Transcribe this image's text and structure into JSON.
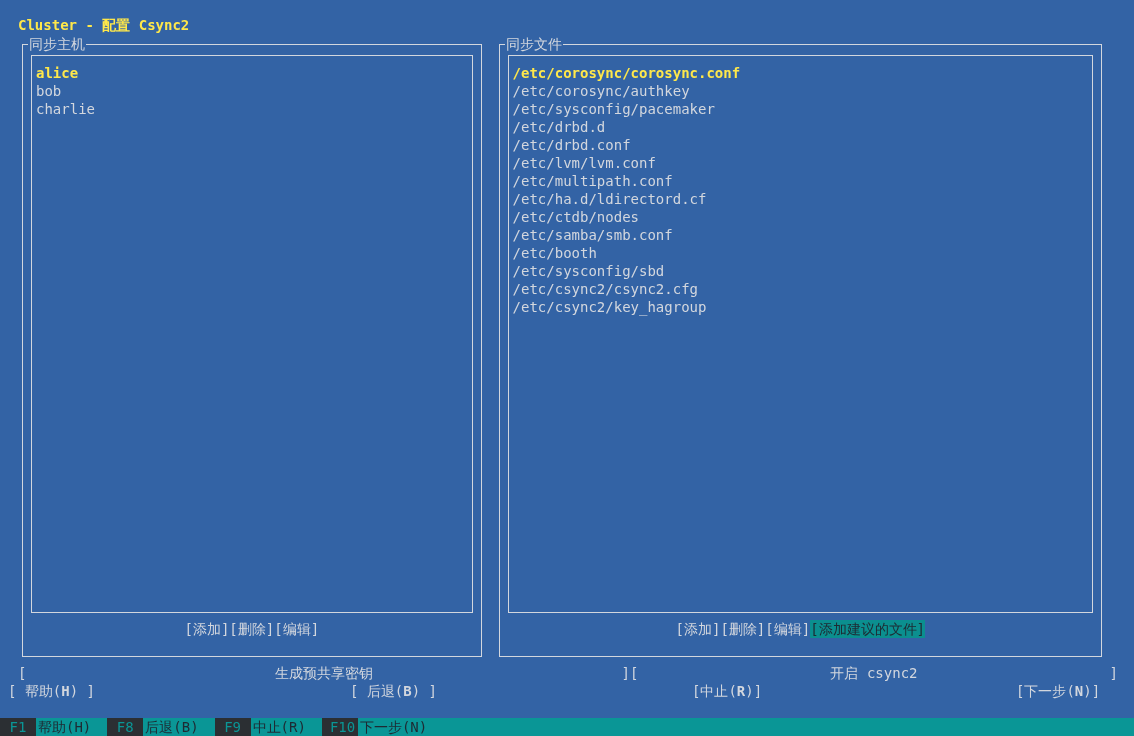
{
  "window": {
    "title": "Cluster - 配置 Csync2"
  },
  "panels": [
    {
      "title": "同步主机",
      "items": [
        {
          "label": "alice",
          "selected": true
        },
        {
          "label": "bob",
          "selected": false
        },
        {
          "label": "charlie",
          "selected": false
        }
      ],
      "buttons": [
        {
          "label": "[添加]",
          "focused": false
        },
        {
          "label": "[删除]",
          "focused": false
        },
        {
          "label": "[编辑]",
          "focused": false
        }
      ]
    },
    {
      "title": "同步文件",
      "items": [
        {
          "label": "/etc/corosync/corosync.conf",
          "selected": true
        },
        {
          "label": "/etc/corosync/authkey",
          "selected": false
        },
        {
          "label": "/etc/sysconfig/pacemaker",
          "selected": false
        },
        {
          "label": "/etc/drbd.d",
          "selected": false
        },
        {
          "label": "/etc/drbd.conf",
          "selected": false
        },
        {
          "label": "/etc/lvm/lvm.conf",
          "selected": false
        },
        {
          "label": "/etc/multipath.conf",
          "selected": false
        },
        {
          "label": "/etc/ha.d/ldirectord.cf",
          "selected": false
        },
        {
          "label": "/etc/ctdb/nodes",
          "selected": false
        },
        {
          "label": "/etc/samba/smb.conf",
          "selected": false
        },
        {
          "label": "/etc/booth",
          "selected": false
        },
        {
          "label": "/etc/sysconfig/sbd",
          "selected": false
        },
        {
          "label": "/etc/csync2/csync2.cfg",
          "selected": false
        },
        {
          "label": "/etc/csync2/key_hagroup",
          "selected": false
        }
      ],
      "buttons": [
        {
          "label": "[添加]",
          "focused": false
        },
        {
          "label": "[删除]",
          "focused": false
        },
        {
          "label": "[编辑]",
          "focused": false
        },
        {
          "label": "[添加建议的文件]",
          "focused": true
        }
      ]
    }
  ],
  "wide_buttons": [
    {
      "open": "[",
      "label": "生成预共享密钥",
      "close": "]"
    },
    {
      "open": "[",
      "label": "开启 csync2",
      "close": "]"
    }
  ],
  "nav_buttons": [
    {
      "label": "[ 帮助(**H**) ]"
    },
    {
      "label": "[ 后退(**B**) ]"
    },
    {
      "label": "[中止(**R**)]"
    },
    {
      "label": "[下一步(**N**)]"
    }
  ],
  "function_keys": [
    {
      "key": "F1",
      "label": "帮助(H)"
    },
    {
      "key": "F8",
      "label": "后退(B)"
    },
    {
      "key": "F9",
      "label": "中止(R)"
    },
    {
      "key": "F10",
      "label": "下一步(N)"
    }
  ]
}
